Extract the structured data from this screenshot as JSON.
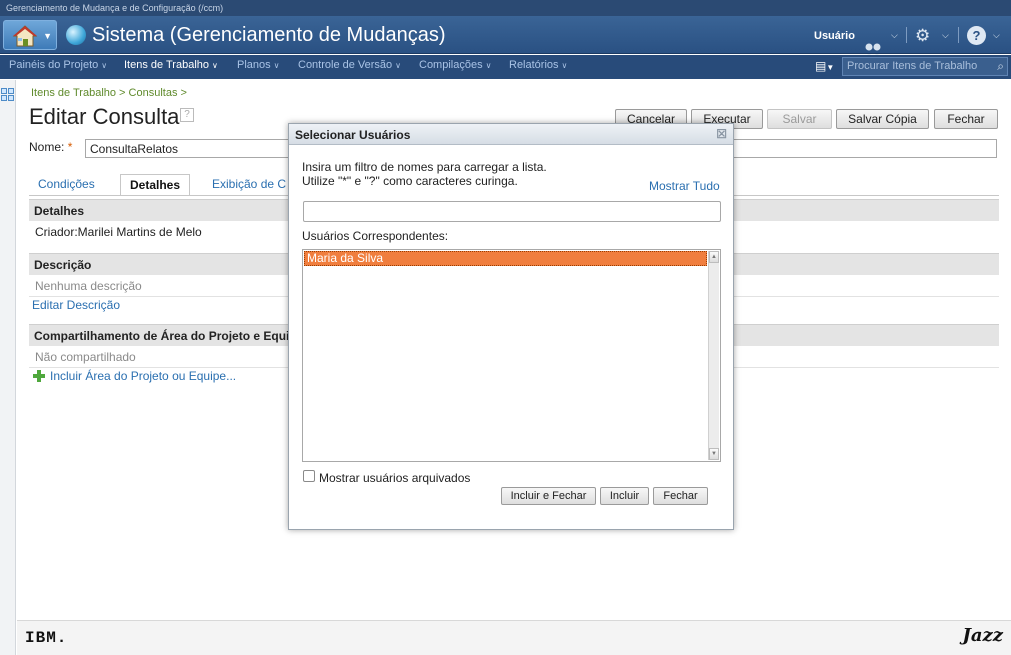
{
  "app": {
    "top_caption": "Gerenciamento de Mudança e de Configuração (/ccm)",
    "title": "Sistema (Gerenciamento de Mudanças)",
    "user_label": "Usuário"
  },
  "nav": {
    "items": [
      {
        "label": "Painéis do Projeto"
      },
      {
        "label": "Itens de Trabalho"
      },
      {
        "label": "Planos"
      },
      {
        "label": "Controle de Versão"
      },
      {
        "label": "Compilações"
      },
      {
        "label": "Relatórios"
      }
    ],
    "search_placeholder": "Procurar Itens de Trabalho"
  },
  "page": {
    "breadcrumb": "Itens de Trabalho > Consultas >",
    "title": "Editar Consulta",
    "name_label": "Nome:",
    "name_required": "*",
    "name_value": "ConsultaRelatos",
    "buttons": {
      "cancel": "Cancelar",
      "run": "Executar",
      "save": "Salvar",
      "save_copy": "Salvar Cópia",
      "close": "Fechar"
    },
    "tabs": [
      {
        "label": "Condições"
      },
      {
        "label": "Detalhes"
      },
      {
        "label": "Exibição de C"
      }
    ],
    "details": {
      "header": "Detalhes",
      "creator": "Criador:Marilei Martins de Melo"
    },
    "description": {
      "header": "Descrição",
      "empty": "Nenhuma descrição",
      "edit_link": "Editar Descrição"
    },
    "sharing": {
      "header": "Compartilhamento de Área do Projeto e Equi",
      "status": "Não compartilhado",
      "add_link": "Incluir Área do Projeto ou Equipe..."
    }
  },
  "footer": {
    "ibm": "IBM.",
    "jazz": "Jazz"
  },
  "dialog": {
    "title": "Selecionar Usuários",
    "close_glyph": "☒",
    "instruction_1": "Insira um filtro de nomes para carregar a lista.",
    "instruction_2": "Utilize \"*\" e \"?\" como caracteres curinga.",
    "show_all": "Mostrar Tudo",
    "filter_value": "",
    "matching_label": "Usuários Correspondentes:",
    "users": [
      {
        "name": "Maria da Silva",
        "selected": true
      }
    ],
    "show_archived_label": "Mostrar usuários arquivados",
    "show_archived_checked": false,
    "buttons": {
      "add_close": "Incluir e Fechar",
      "add": "Incluir",
      "close": "Fechar"
    }
  },
  "colors": {
    "banner": "#2a5183",
    "selection": "#f07e3e",
    "link": "#2a6fb0",
    "breadcrumb": "#5f8a2b"
  }
}
